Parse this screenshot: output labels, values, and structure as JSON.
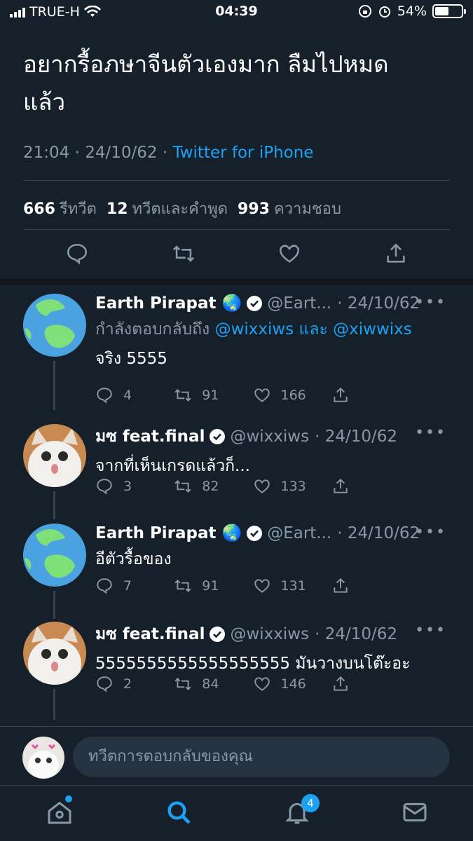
{
  "status_bar": {
    "carrier": "TRUE-H",
    "time": "04:39",
    "battery": "54%",
    "battery_level": 0.54
  },
  "tweet": {
    "text_line1": "อยากรื้อภษาจีนตัวเองมาก ลืมไปหมด",
    "text_line2": "แล้ว",
    "time": "21:04",
    "date": "24/10/62",
    "source": "Twitter for iPhone",
    "retweets_count": "666",
    "retweets_label": "รีทวีต",
    "quotes_count": "12",
    "quotes_label": "ทวีตและคำพูด",
    "likes_count": "993",
    "likes_label": "ความชอบ"
  },
  "replies": [
    {
      "name": "Earth Pirapat",
      "emoji": "🌏",
      "handle": "@Eart...",
      "date": "· 24/10/62",
      "replying_prefix": "กำลังตอบกลับถึง",
      "replying_user1": "@wixxiws",
      "replying_and": "และ",
      "replying_user2": "@xiwwixs",
      "text": "จริง 5555",
      "replies": "4",
      "retweets": "91",
      "likes": "166"
    },
    {
      "name": "มซ feat.final",
      "handle": "@wixxiws",
      "date": "· 24/10/62",
      "text": "จากที่เห็นเกรดแล้วก็...",
      "replies": "3",
      "retweets": "82",
      "likes": "133"
    },
    {
      "name": "Earth Pirapat",
      "emoji": "🌏",
      "handle": "@Eart...",
      "date": "· 24/10/62",
      "text": "อีตัวรื้อของ",
      "replies": "7",
      "retweets": "91",
      "likes": "131"
    },
    {
      "name": "มซ feat.final",
      "handle": "@wixxiws",
      "date": "· 24/10/62",
      "text": "5555555555555555555 มันวางบนโต๊ะอะ",
      "replies": "2",
      "retweets": "84",
      "likes": "146"
    }
  ],
  "compose": {
    "placeholder": "ทวีตการตอบกลับของคุณ"
  },
  "tabbar": {
    "notifications_badge": "4"
  },
  "colors": {
    "background": "#15202b",
    "accent": "#1da1f2",
    "muted": "#8899a6",
    "divider": "#38444d"
  }
}
